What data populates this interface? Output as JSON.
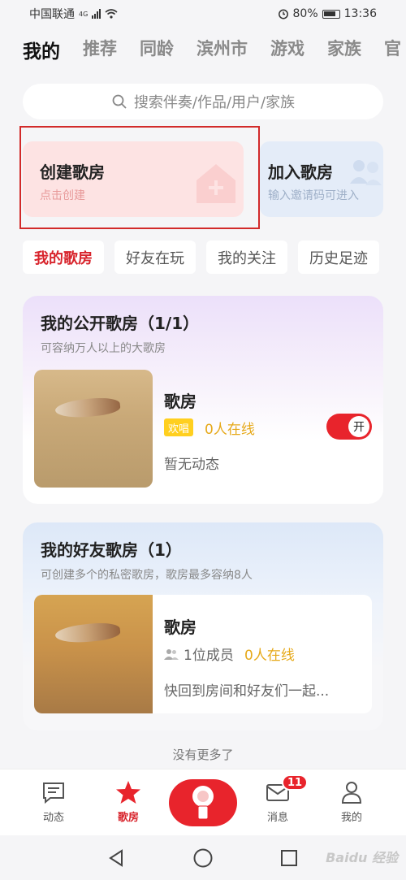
{
  "status_bar": {
    "carrier": "中国联通",
    "network": "4G",
    "battery": "80%",
    "time": "13:36"
  },
  "top_tabs": [
    "我的",
    "推荐",
    "同龄",
    "滨州市",
    "游戏",
    "家族",
    "官"
  ],
  "search": {
    "placeholder": "搜索伴奏/作品/用户/家族"
  },
  "create_room": {
    "title": "创建歌房",
    "subtitle": "点击创建"
  },
  "join_room": {
    "title": "加入歌房",
    "subtitle": "输入邀请码可进入"
  },
  "filter_chips": [
    "我的歌房",
    "好友在玩",
    "我的关注",
    "历史足迹"
  ],
  "public_rooms": {
    "title": "我的公开歌房（1/1）",
    "desc": "可容纳万人以上的大歌房",
    "room": {
      "name": "歌房",
      "tag": "欢唱",
      "online": "0人在线",
      "status": "暂无动态",
      "toggle_label": "开"
    }
  },
  "friend_rooms": {
    "title": "我的好友歌房（1）",
    "desc": "可创建多个的私密歌房，歌房最多容纳8人",
    "room": {
      "name": "歌房",
      "members": "1位成员",
      "online": "0人在线",
      "status": "快回到房间和好友们一起..."
    }
  },
  "footer_text": "没有更多了",
  "bottom_nav": {
    "items": [
      "动态",
      "歌房",
      "消息",
      "我的"
    ],
    "active": "歌房",
    "messages_badge": "11"
  },
  "watermark": "Baidu 经验",
  "colors": {
    "accent": "#e8242c",
    "online": "#e6a91a",
    "tag": "#ffcf1f"
  }
}
